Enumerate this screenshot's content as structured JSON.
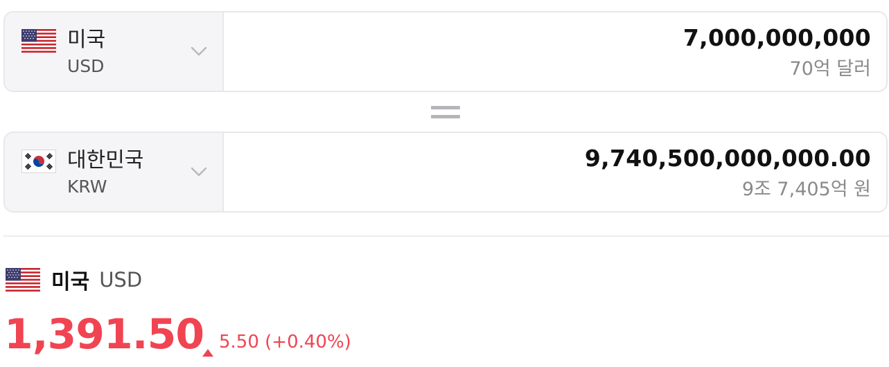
{
  "converter": {
    "from": {
      "flag_icon": "us-flag-icon",
      "name": "미국",
      "code": "USD",
      "amount": "7,000,000,000",
      "amount_words": "70억 달러"
    },
    "to": {
      "flag_icon": "kr-flag-icon",
      "name": "대한민국",
      "code": "KRW",
      "amount": "9,740,500,000,000.00",
      "amount_words": "9조 7,405억 원"
    },
    "separator_icon": "equals-icon",
    "dropdown_icon": "chevron-down-icon"
  },
  "rate": {
    "flag_icon": "us-flag-icon",
    "name": "미국",
    "code": "USD",
    "value": "1,391.50",
    "change_icon": "up-triangle-icon",
    "change": "5.50 (+0.40%)",
    "color": "#f04452"
  }
}
